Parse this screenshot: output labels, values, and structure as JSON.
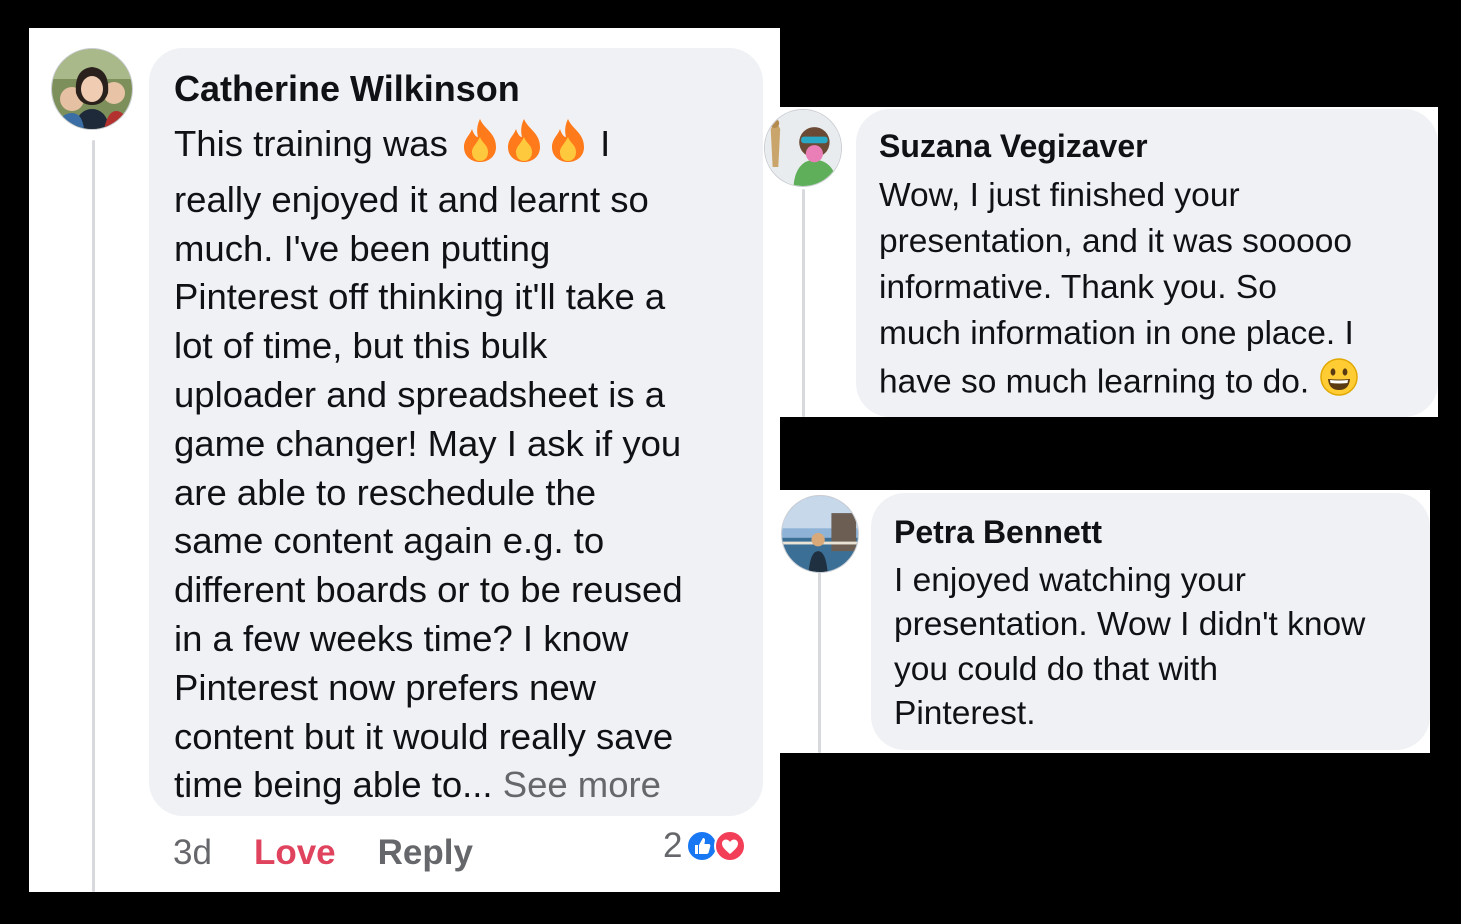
{
  "comments": [
    {
      "author": "Catherine Wilkinson",
      "lines": [
        "This training was",
        "really enjoyed it and learnt so",
        "much. I've been putting",
        "Pinterest off thinking it'll take a",
        "lot of time, but this bulk",
        "uploader and spreadsheet is a",
        "game changer! May I ask if you",
        "are able to reschedule the",
        "same content again e.g. to",
        "different boards or to be reused",
        "in a few weeks time? I know",
        "Pinterest now prefers new",
        "content but it would really save",
        "time being able to..."
      ],
      "line1_after_emoji": "I",
      "inline_emoji": [
        "fire-emoji",
        "fire-emoji",
        "fire-emoji"
      ],
      "see_more": "See more",
      "timestamp": "3d",
      "love_label": "Love",
      "reply_label": "Reply",
      "reaction_count": "2",
      "reaction_icons": [
        "like-reaction-icon",
        "love-reaction-icon"
      ],
      "colors": {
        "love": "#e0435d",
        "like": "#1877f2",
        "heart": "#f33e58",
        "bubble": "#eff1f5",
        "muted": "#65676b"
      }
    },
    {
      "author": "Suzana Vegizaver",
      "lines": [
        "Wow, I just finished your",
        "presentation, and it was sooooo",
        "informative. Thank you. So",
        "much information in one place. I",
        "have so much learning to do."
      ],
      "trailing_emoji": "grinning-face-emoji"
    },
    {
      "author": "Petra Bennett",
      "lines": [
        "I enjoyed watching your",
        "presentation. Wow I didn't know",
        "you could do that with",
        "Pinterest."
      ]
    }
  ]
}
